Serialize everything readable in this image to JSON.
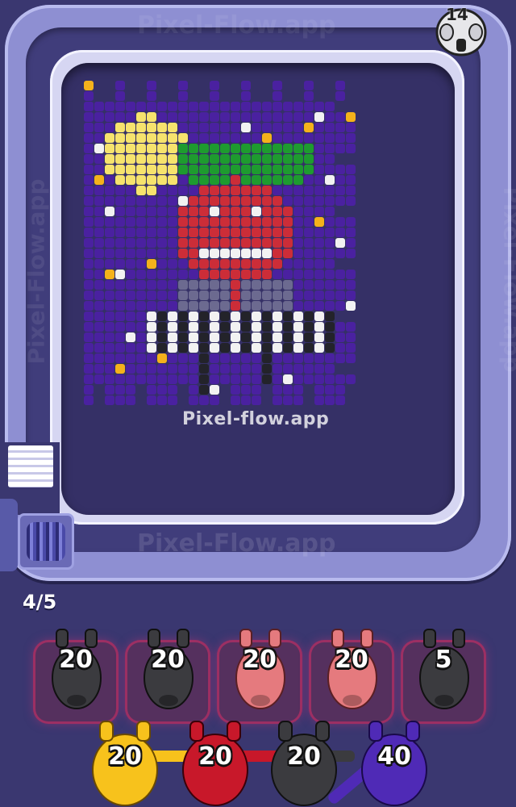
{
  "watermark": {
    "top": "Pixel-Flow.app",
    "bottom": "Pixel-Flow.app",
    "left": "Pixel-Flow.app",
    "right": "Pixel-Flow.app",
    "center": "Pixel-flow.app"
  },
  "counter": {
    "value": "14"
  },
  "progress": {
    "label": "4/5"
  },
  "slots": [
    {
      "color": "black",
      "count": "20"
    },
    {
      "color": "black",
      "count": "20"
    },
    {
      "color": "pink",
      "count": "20"
    },
    {
      "color": "pink",
      "count": "20"
    },
    {
      "color": "black",
      "count": "5"
    }
  ],
  "queue": [
    {
      "color": "yellow",
      "count": "20"
    },
    {
      "color": "red",
      "count": "20"
    },
    {
      "color": "black",
      "count": "20"
    },
    {
      "color": "purple",
      "count": "40"
    }
  ],
  "colors": {
    "black": "#3b3b3f",
    "pink": "#e57a7e",
    "yellow": "#f7c21c",
    "red": "#c8182a",
    "purple": "#4f2ab6",
    "night": "#4a21a0",
    "moon": "#f6e36d",
    "gold": "#f4b21b",
    "leaf": "#1e9b2f",
    "tomato": "#cc2d38",
    "white": "#f2f2f2",
    "suit": "#6c6a90",
    "dark": "#23232a"
  }
}
